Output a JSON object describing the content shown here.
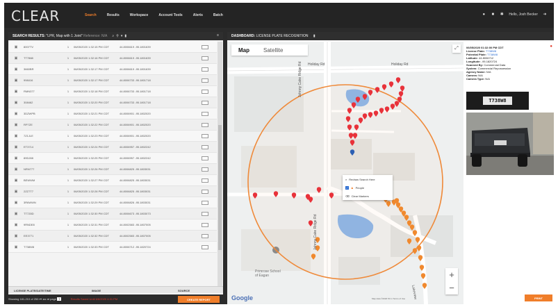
{
  "app": {
    "logo": "CLEAR",
    "nav": [
      "Search",
      "Results",
      "Workspace",
      "Account Tools",
      "Alerts",
      "Batch"
    ],
    "active_nav": 0,
    "user": "Hello, Josh Becker",
    "accent": "#f07e2a"
  },
  "search_results": {
    "label": "SEARCH RESULTS:",
    "query": "\"LPR, Map with 1 Joint\"",
    "reference": "Reference: N/A",
    "tools": [
      "search-icon",
      "pin-icon",
      "filter-icon",
      "bookmark-icon"
    ],
    "menu_icon": "menu-icon",
    "rows": [
      {
        "plate": "8007TV",
        "count": "1",
        "date": "06/05/2020 1:32:15 PM CDT",
        "coords": "44.8006619 -95.1801639"
      },
      {
        "plate": "TT7888",
        "count": "1",
        "date": "06/05/2020 1:32:16 PM CDT",
        "coords": "44.8006619 -95.1801639"
      },
      {
        "plate": "3660BR",
        "count": "1",
        "date": "06/05/2020 1:32:17 PM CDT",
        "coords": "44.8006619 -95.1801639"
      },
      {
        "plate": "998416",
        "count": "1",
        "date": "06/05/2020 1:32:17 PM CDT",
        "coords": "44.8006733 -95.1801718"
      },
      {
        "plate": "RMN377",
        "count": "1",
        "date": "06/05/2020 1:32:18 PM CDT",
        "coords": "44.8006733 -95.1801718"
      },
      {
        "plate": "308462",
        "count": "1",
        "date": "06/05/2020 1:32:20 PM CDT",
        "coords": "44.8006733 -95.1801718"
      },
      {
        "plate": "3DZWPB",
        "count": "1",
        "date": "06/05/2020 1:32:21 PM CDT",
        "coords": "44.8006901 -95.1802020"
      },
      {
        "plate": "RP7ZE",
        "count": "1",
        "date": "06/05/2020 1:32:22 PM CDT",
        "coords": "44.8006901 -95.1802020"
      },
      {
        "plate": "7Z1JLE",
        "count": "1",
        "date": "06/05/2020 1:32:23 PM CDT",
        "coords": "44.8006901 -95.1802020"
      },
      {
        "plate": "ET3714",
        "count": "1",
        "date": "06/05/2020 1:32:24 PM CDT",
        "coords": "44.8006957 -95.1802242"
      },
      {
        "plate": "89DJ88",
        "count": "1",
        "date": "06/05/2020 1:32:25 PM CDT",
        "coords": "44.8006957 -95.1802242"
      },
      {
        "plate": "NRN777",
        "count": "1",
        "date": "06/05/2020 1:32:26 PM CDT",
        "coords": "44.8006825 -95.1803031"
      },
      {
        "plate": "BEWWM",
        "count": "1",
        "date": "06/05/2020 1:32:27 PM CDT",
        "coords": "44.8006825 -95.1803031"
      },
      {
        "plate": "2ZZ7T7",
        "count": "1",
        "date": "06/05/2020 1:32:28 PM CDT",
        "coords": "44.8006825 -95.1803031"
      },
      {
        "plate": "3R6WWN",
        "count": "1",
        "date": "06/05/2020 1:32:29 PM CDT",
        "coords": "44.8006826 -95.1803031"
      },
      {
        "plate": "TT7Z8D",
        "count": "1",
        "date": "06/05/2020 1:32:30 PM CDT",
        "coords": "44.8006673 -95.1803073"
      },
      {
        "plate": "9RNDE8",
        "count": "1",
        "date": "06/05/2020 1:32:31 PM CDT",
        "coords": "44.8002583 -95.1807005"
      },
      {
        "plate": "EE3771",
        "count": "1",
        "date": "06/05/2020 1:32:32 PM CDT",
        "coords": "44.8002583 -95.1807005"
      },
      {
        "plate": "T738W8",
        "count": "1",
        "date": "06/05/2020 1:32:33 PM CDT",
        "coords": "44.8006712 -95.1820724"
      }
    ],
    "subheaders": [
      "LICENSE PLATE/DATE/TIME",
      "IMAGE",
      "SOURCE"
    ],
    "footer": {
      "showing": "Showing 181-210 of 250",
      "page_label": "page",
      "page_value": "7",
      "notice": "Results Saved Until 6/6/2020 4:31 PM",
      "create_report": "CREATE REPORT"
    }
  },
  "dashboard": {
    "label": "DASHBOARD:",
    "title": "LICENSE PLATE RECOGNITION",
    "map": {
      "tabs": [
        "Map",
        "Satellite"
      ],
      "active_tab": 0,
      "road_labels": [
        "Holiday Rd",
        "Johnny Cake Ridge Rd",
        "Lakeview"
      ],
      "school_label": "Primrose School of Eagan",
      "context_menu": [
        "Redraw Search Here",
        "People",
        "Clear Markers"
      ],
      "google": "Google",
      "attribution": "Map data ©2020   50 m   Terms of Use",
      "print_label": "PRINT"
    },
    "detail": {
      "datetime": "06/05/2020 01:32:00 PM CDT",
      "fields": [
        {
          "label": "License Plate:",
          "value": "T738W8",
          "highlight": true
        },
        {
          "label": "Potential Plate:",
          "value": "T738W8",
          "highlight": true
        },
        {
          "label": "Latitude:",
          "value": "44.8006712",
          "highlight": false
        },
        {
          "label": "Longitude:",
          "value": "-95.1820724",
          "highlight": false
        },
        {
          "label": "Scanned By:",
          "value": "Commercial Data",
          "highlight": false
        },
        {
          "label": "System:",
          "value": "Commercial Repossession",
          "highlight": false
        },
        {
          "label": "Agency Name:",
          "value": "N/A",
          "highlight": false
        },
        {
          "label": "Camera:",
          "value": "N/A",
          "highlight": false
        },
        {
          "label": "Camera Type:",
          "value": "N/A",
          "highlight": false
        }
      ],
      "plate_text": "T738W8"
    }
  }
}
